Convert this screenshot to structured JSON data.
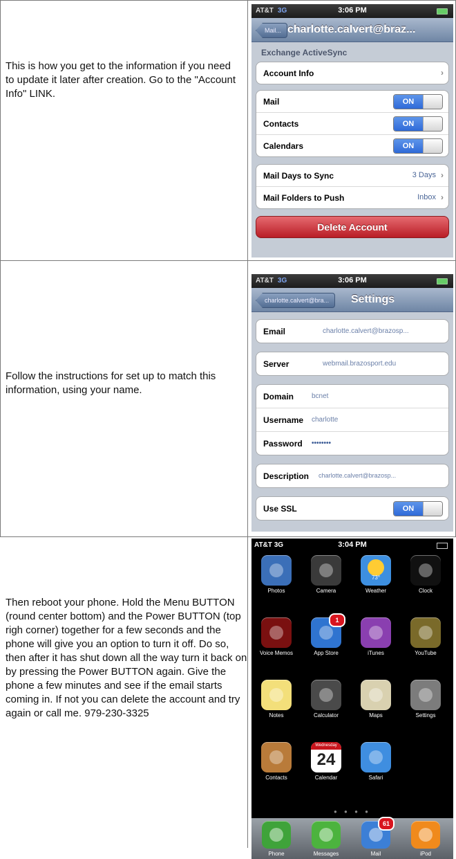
{
  "instructions": [
    "This is how you get to the information if you need to update it later after creation.  Go to the \"Account Info\" LINK.",
    "Follow the instructions for set up to match this information, using your name.",
    "Then reboot your phone.  Hold the Menu BUTTON (round center bottom) and the Power BUTTON (top righ corner) together for a few seconds and the phone will give you an option to turn it off.  Do so, then after it has shut down all the way turn it back on by pressing the Power BUTTON again.  Give the phone a few minutes and see if the email starts coming in.  If not you can delete the account and try again or call me.  979-230-3325"
  ],
  "screen1": {
    "carrier": "AT&T",
    "network": "3G",
    "time": "3:06 PM",
    "back": "Mail...",
    "title": "charlotte.calvert@braz...",
    "section": "Exchange ActiveSync",
    "account_info": "Account Info",
    "toggles": [
      {
        "label": "Mail",
        "state": "ON"
      },
      {
        "label": "Contacts",
        "state": "ON"
      },
      {
        "label": "Calendars",
        "state": "ON"
      }
    ],
    "sync_rows": [
      {
        "label": "Mail Days to Sync",
        "value": "3 Days"
      },
      {
        "label": "Mail Folders to Push",
        "value": "Inbox"
      }
    ],
    "delete": "Delete Account"
  },
  "screen2": {
    "carrier": "AT&T",
    "network": "3G",
    "time": "3:06 PM",
    "back": "charlotte.calvert@bra...",
    "title": "Settings",
    "email_label": "Email",
    "email_value": "charlotte.calvert@brazosp...",
    "server_label": "Server",
    "server_value": "webmail.brazosport.edu",
    "domain_label": "Domain",
    "domain_value": "bcnet",
    "username_label": "Username",
    "username_value": "charlotte",
    "password_label": "Password",
    "password_value": "••••••••",
    "description_label": "Description",
    "description_value": "charlotte.calvert@brazosp...",
    "ssl_label": "Use SSL",
    "ssl_state": "ON"
  },
  "screen3": {
    "carrier": "AT&T",
    "network": "3G",
    "time": "3:04 PM",
    "apps": [
      {
        "name": "Photos",
        "icon": "sunflower-icon",
        "color": "#3b6fb8"
      },
      {
        "name": "Camera",
        "icon": "camera-lens-icon",
        "color": "#3a3a3a"
      },
      {
        "name": "Weather",
        "icon": "sun-icon",
        "color": "#3d8fe0",
        "temp": "73°"
      },
      {
        "name": "Clock",
        "icon": "clock-icon",
        "color": "#111111"
      },
      {
        "name": "Voice Memos",
        "icon": "microphone-icon",
        "color": "#7a1010"
      },
      {
        "name": "App Store",
        "icon": "app-store-icon",
        "color": "#2f74d0",
        "badge": "1"
      },
      {
        "name": "iTunes",
        "icon": "music-note-icon",
        "color": "#8a3fb0"
      },
      {
        "name": "YouTube",
        "icon": "tv-icon",
        "color": "#7a6a2a"
      },
      {
        "name": "Notes",
        "icon": "notepad-icon",
        "color": "#f3df7a"
      },
      {
        "name": "Calculator",
        "icon": "calculator-icon",
        "color": "#4a4a4a"
      },
      {
        "name": "Maps",
        "icon": "map-pin-icon",
        "color": "#d9d1b0"
      },
      {
        "name": "Settings",
        "icon": "gear-icon",
        "color": "#7c7c7c"
      },
      {
        "name": "Contacts",
        "icon": "contacts-book-icon",
        "color": "#b97b3a"
      },
      {
        "name": "Calendar",
        "icon": "calendar-icon",
        "color": "#ffffff",
        "day": "Wednesday",
        "date": "24"
      },
      {
        "name": "Safari",
        "icon": "compass-icon",
        "color": "#3f8ee0"
      }
    ],
    "dock": [
      {
        "name": "Phone",
        "icon": "phone-handset-icon",
        "color": "#3fa33a"
      },
      {
        "name": "Messages",
        "icon": "speech-bubble-icon",
        "color": "#4cb33e"
      },
      {
        "name": "Mail",
        "icon": "envelope-icon",
        "color": "#3c7fd6",
        "badge": "61"
      },
      {
        "name": "iPod",
        "icon": "ipod-icon",
        "color": "#f08a1c"
      }
    ]
  }
}
